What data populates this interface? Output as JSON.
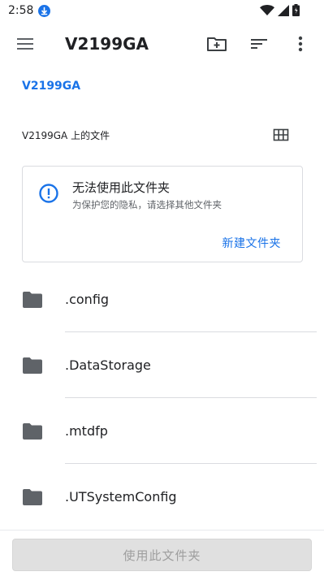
{
  "status_bar": {
    "time": "2:58",
    "icons": [
      "download-icon",
      "wifi-icon",
      "signal-icon",
      "battery-icon"
    ]
  },
  "app_bar": {
    "title": "V2199GA",
    "icons": [
      "menu-icon",
      "new-folder-icon",
      "sort-icon",
      "more-vert-icon"
    ]
  },
  "breadcrumb": "V2199GA",
  "section": {
    "label": "V2199GA 上的文件",
    "view_icon": "grid-view-icon"
  },
  "card": {
    "icon": "info-icon",
    "title": "无法使用此文件夹",
    "subtitle": "为保护您的隐私，请选择其他文件夹",
    "action": "新建文件夹"
  },
  "list": [
    {
      "name": ".config"
    },
    {
      "name": ".DataStorage"
    },
    {
      "name": ".mtdfp"
    },
    {
      "name": ".UTSystemConfig"
    }
  ],
  "bottom": {
    "use_button": "使用此文件夹"
  },
  "colors": {
    "accent": "#1a73e8",
    "folder": "#5f6368",
    "divider": "#dadce0",
    "disabled_button_bg": "#e0e0e0",
    "disabled_button_text": "#9e9e9e"
  }
}
